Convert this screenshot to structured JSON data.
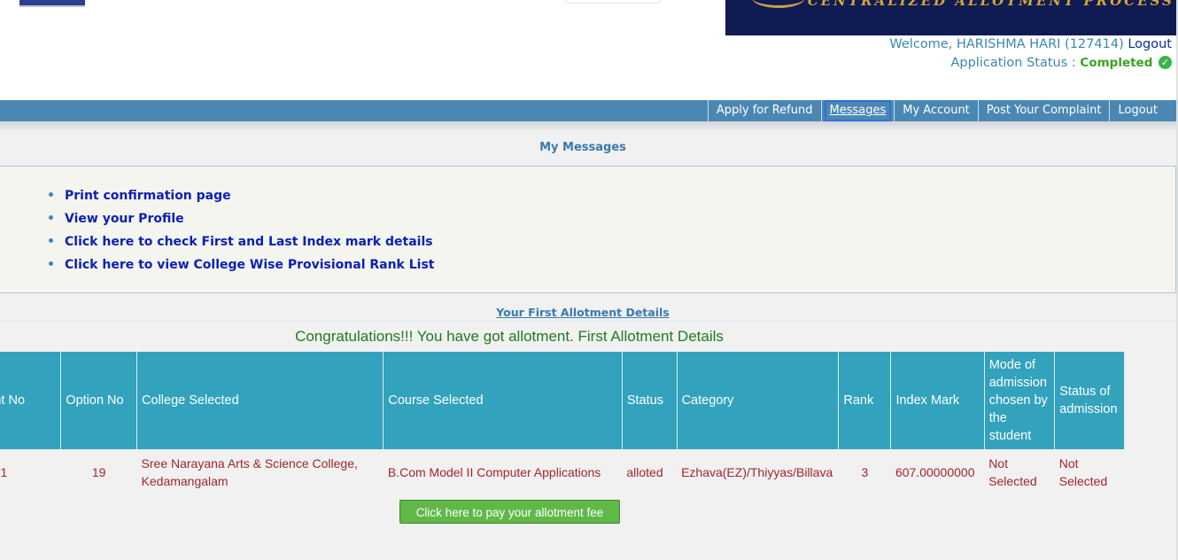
{
  "header": {
    "banner_text": "CENTRALIZED ALLOTMENT PROCESS",
    "welcome_prefix": "Welcome, HARISHMA HARI (127414)",
    "logout_link": "Logout",
    "status_label": "Application Status :",
    "status_value": "Completed",
    "status_color": "#3aa31f"
  },
  "nav": {
    "items": [
      {
        "label": "Apply for Refund"
      },
      {
        "label": "Messages",
        "active": true
      },
      {
        "label": "My Account"
      },
      {
        "label": "Post Your Complaint"
      },
      {
        "label": "Logout"
      }
    ]
  },
  "messages": {
    "title": "My Messages",
    "links": [
      "Print confirmation page",
      "View your Profile",
      "Click here to check First and Last Index mark details",
      "Click here to view College Wise Provisional Rank List"
    ]
  },
  "allotment": {
    "title": "Your First Allotment Details",
    "congrats": "Congratulations!!! You have got allotment. First Allotment Details",
    "headers": [
      "Allotment No",
      "Option No",
      "College Selected",
      "Course Selected",
      "Status",
      "Category",
      "Rank",
      "Index Mark",
      "Mode of admission chosen by the student",
      "Status of admission"
    ],
    "row": {
      "allotment_no": "1",
      "option_no": "19",
      "college": "Sree Narayana Arts & Science College, Kedamangalam",
      "course": "B.Com Model II Computer Applications",
      "status": "alloted",
      "category": "Ezhava(EZ)/Thiyyas/Billava",
      "rank": "3",
      "index_mark": "607.00000000",
      "mode": "Not Selected",
      "admission_status": "Not Selected"
    },
    "pay_button": "Click here to pay your allotment fee"
  },
  "colors": {
    "nav_bg": "#4a88b3",
    "table_header_bg": "#33a2bd",
    "row_text": "#a1262b",
    "link_text": "#0b20b5",
    "pay_button_bg": "#5fb848"
  }
}
